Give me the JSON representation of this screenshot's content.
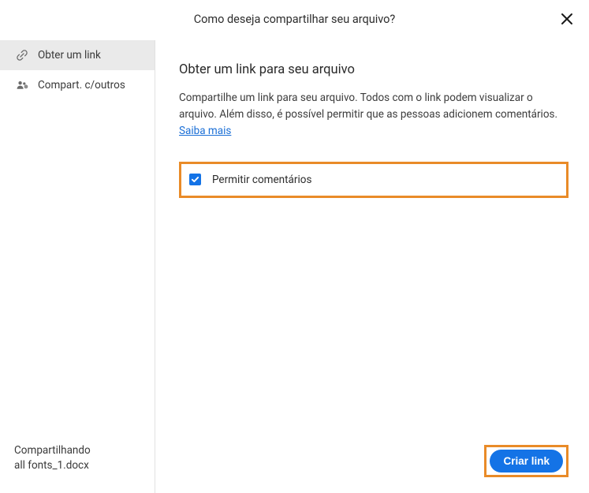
{
  "header": {
    "title": "Como deseja compartilhar seu arquivo?"
  },
  "sidebar": {
    "items": [
      {
        "label": "Obter um link"
      },
      {
        "label": "Compart. c/outros"
      }
    ],
    "footer_line1": "Compartilhando",
    "footer_line2": "all fonts_1.docx"
  },
  "main": {
    "title": "Obter um link para seu arquivo",
    "description_part1": "Compartilhe um link para seu arquivo. Todos com o link podem visualizar o arquivo. Além disso, é possível permitir que as pessoas adicionem comentários. ",
    "learn_more": "Saiba mais",
    "checkbox_label": "Permitir comentários",
    "primary_button": "Criar link"
  }
}
